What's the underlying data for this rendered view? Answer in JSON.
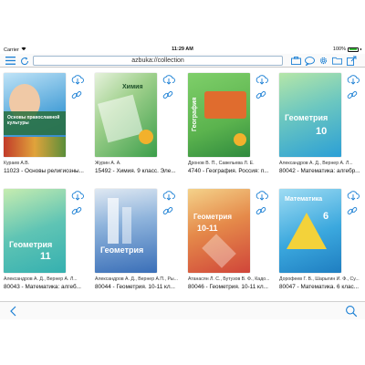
{
  "status": {
    "carrier": "Carrier",
    "time": "11:29 AM",
    "battery": "100%"
  },
  "toolbar": {
    "address": "azbuka://collection"
  },
  "books": [
    {
      "author": "Кураев А.В.",
      "title": "11023 - Основы религиозны...",
      "cover_text": "Основы православной культуры",
      "cover_color": "#2a7bbf"
    },
    {
      "author": "Журин А. А.",
      "title": "15492 - Химия. 9 класс. Эле...",
      "cover_text": "Химия",
      "cover_color": "#3b9e4a"
    },
    {
      "author": "Дронов В. П., Савельева Л. Е.",
      "title": "4740 - География. Россия: п...",
      "cover_text": "География",
      "cover_color": "#5bb34e"
    },
    {
      "author": "Александров А. Д., Вернер А. Л...",
      "title": "80042 - Математика: алгебр...",
      "cover_text": "Геометрия",
      "cover_color": "#2b9fd6",
      "cover_number": "10"
    },
    {
      "author": "Александров А. Д., Вернер А. Л...",
      "title": "80043 - Математика: алгеб...",
      "cover_text": "Геометрия",
      "cover_color": "#35b0b0",
      "cover_number": "11"
    },
    {
      "author": "Александров А. Д., Вернер А.П., Ры...",
      "title": "80044 - Геометрия. 10-11 кл...",
      "cover_text": "Геометрия",
      "cover_color": "#3a6fb8"
    },
    {
      "author": "Атанасян Л. С., Бутузов В. Ф., Кадо...",
      "title": "80046 - Геометрия. 10-11 кл...",
      "cover_text": "Геометрия",
      "cover_color": "#d0453a",
      "cover_number": "10-11"
    },
    {
      "author": "Дорофеев Г. В., Шарыгин И. Ф., Су...",
      "title": "80047 - Математика. 6 клас...",
      "cover_text": "Математика",
      "cover_color": "#3ba8de",
      "cover_number": "6"
    }
  ],
  "icons": {
    "menu": "menu-icon",
    "refresh": "refresh-icon",
    "briefcase": "briefcase-icon",
    "chat": "chat-icon",
    "settings": "gear-icon",
    "folder": "folder-icon",
    "export": "export-icon",
    "download": "cloud-download-icon",
    "link": "link-icon",
    "back": "chevron-left-icon",
    "search": "search-icon"
  },
  "colors": {
    "accent": "#1a7fd4"
  }
}
